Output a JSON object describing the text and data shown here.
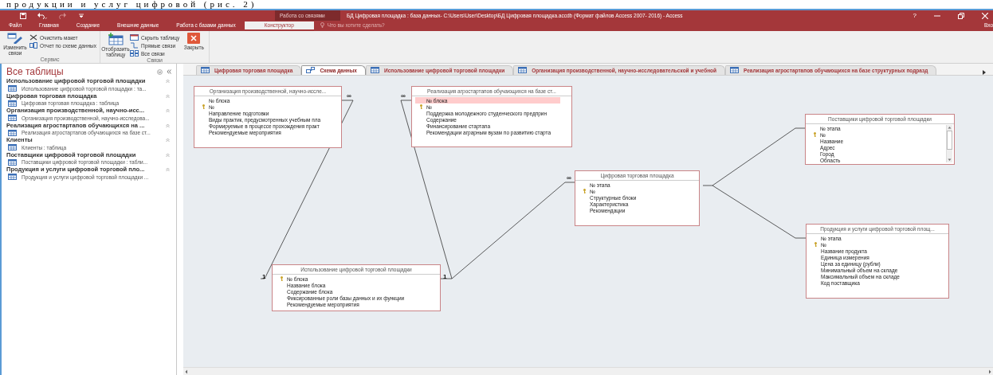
{
  "document_caption": "продукции и услуг цифровой (рис. 2)",
  "window": {
    "context_title": "Работа со связями",
    "title": "БД Цифровая площадка : база данных- C:\\Users\\User\\Desktop\\БД Цифровая площадка.accdb (Формат файлов Access 2007- 2016) - Access",
    "help": "?",
    "sign_in": "Вхо"
  },
  "ribbon_tabs": [
    {
      "label": "Файл",
      "selected": false
    },
    {
      "label": "Главная",
      "selected": false
    },
    {
      "label": "Создание",
      "selected": false
    },
    {
      "label": "Внешние данные",
      "selected": false
    },
    {
      "label": "Работа с базами данных",
      "selected": false
    },
    {
      "label": "Конструктор",
      "selected": true
    }
  ],
  "tell_me": {
    "placeholder": "Что вы хотите сделать?"
  },
  "ribbon_groups": [
    {
      "label": "Сервис",
      "items": [
        {
          "label": "Изменить связи",
          "kind": "large"
        },
        {
          "label": "Очистить макет",
          "kind": "small"
        },
        {
          "label": "Отчет по схеме данных",
          "kind": "small"
        }
      ]
    },
    {
      "label": "Связи",
      "items": [
        {
          "label": "Отобразить таблицу",
          "kind": "large"
        },
        {
          "label": "Скрыть таблицу",
          "kind": "small"
        },
        {
          "label": "Прямые связи",
          "kind": "small"
        },
        {
          "label": "Все связи",
          "kind": "small"
        },
        {
          "label": "Закрыть",
          "kind": "large"
        }
      ]
    }
  ],
  "navigation": {
    "title": "Все таблицы",
    "groups": [
      {
        "label": "Использование цифровой торговой площадки",
        "items": [
          "Использование цифровой торговой площадки : та..."
        ]
      },
      {
        "label": "Цифровая торговая площадка",
        "items": [
          "Цифровая торговая площадка : таблица"
        ]
      },
      {
        "label": "Организация производственной, научно-исс...",
        "items": [
          "Организация производственной, научно-исследова..."
        ]
      },
      {
        "label": "Реализация агростартапов обучающихся на ...",
        "items": [
          "Реализация агростартапов обучающихся на базе ст..."
        ]
      },
      {
        "label": "Клиенты",
        "items": [
          "Клиенты : таблица"
        ]
      },
      {
        "label": "Поставщики цифровой торговой площадки",
        "items": [
          "Поставщики цифровой торговой площадки : табли..."
        ]
      },
      {
        "label": "Продукция и услуги цифровой торговой пло...",
        "items": [
          "Продукция и услуги цифровой торговой площадки ..."
        ]
      }
    ]
  },
  "document_tabs": [
    {
      "label": "Цифровая торговая площадка",
      "kind": "table",
      "selected": false
    },
    {
      "label": "Схема данных",
      "kind": "relationships",
      "selected": true
    },
    {
      "label": "Использование цифровой торговой площадки",
      "kind": "table",
      "selected": false
    },
    {
      "label": "Организация производственной, научно-исследовательской и учебной",
      "kind": "table",
      "selected": false
    },
    {
      "label": "Реализация агростартапов обучающихся на базе структурных подразд",
      "kind": "table",
      "selected": false
    }
  ],
  "tables": [
    {
      "title": "Организация производственной, научно-иссле...",
      "fields": [
        {
          "name": "№ блока",
          "key": false,
          "selected": false
        },
        {
          "name": "№",
          "key": true,
          "selected": false
        },
        {
          "name": "Направление подготовки",
          "key": false,
          "selected": false
        },
        {
          "name": "Виды практик, предусмотренных учебным пла",
          "key": false,
          "selected": false
        },
        {
          "name": "Формируемые в процессе прохождения практ",
          "key": false,
          "selected": false
        },
        {
          "name": "Рекомендуемые мероприятия",
          "key": false,
          "selected": false
        }
      ]
    },
    {
      "title": "Реализация агростартапов обучающихся на базе ст...",
      "fields": [
        {
          "name": "№ блока",
          "key": false,
          "selected": true
        },
        {
          "name": "№",
          "key": true,
          "selected": false
        },
        {
          "name": "Поддержка молодежного студенческого предприн",
          "key": false,
          "selected": false
        },
        {
          "name": "Содержание",
          "key": false,
          "selected": false
        },
        {
          "name": "Финансирование стартапа",
          "key": false,
          "selected": false
        },
        {
          "name": "Рекомендации аграрным вузам по развитию старта",
          "key": false,
          "selected": false
        }
      ]
    },
    {
      "title": "Использование цифровой торговой площадки",
      "fields": [
        {
          "name": "№ блока",
          "key": true,
          "selected": false
        },
        {
          "name": "Название блока",
          "key": false,
          "selected": false
        },
        {
          "name": "Содержание блока",
          "key": false,
          "selected": false
        },
        {
          "name": "Фиксированные роли базы данных и их функции",
          "key": false,
          "selected": false
        },
        {
          "name": "Рекомендуемые мероприятия",
          "key": false,
          "selected": false
        }
      ]
    },
    {
      "title": "Цифровая торговая площадка",
      "fields": [
        {
          "name": "№ этапа",
          "key": false,
          "selected": false
        },
        {
          "name": "№",
          "key": true,
          "selected": false
        },
        {
          "name": "Структурные блоки",
          "key": false,
          "selected": false
        },
        {
          "name": "Характеристика",
          "key": false,
          "selected": false
        },
        {
          "name": "Рекомендации",
          "key": false,
          "selected": false
        }
      ]
    },
    {
      "title": "Поставщики цифровой торговой площадки",
      "fields": [
        {
          "name": "№ этапа",
          "key": false,
          "selected": false
        },
        {
          "name": "№",
          "key": true,
          "selected": false
        },
        {
          "name": "Название",
          "key": false,
          "selected": false
        },
        {
          "name": "Адрес",
          "key": false,
          "selected": false
        },
        {
          "name": "Город",
          "key": false,
          "selected": false
        },
        {
          "name": "Область",
          "key": false,
          "selected": false
        }
      ]
    },
    {
      "title": "Продукция и услуги цифровой торговой площ...",
      "fields": [
        {
          "name": "№ этапа",
          "key": false,
          "selected": false
        },
        {
          "name": "№",
          "key": true,
          "selected": false
        },
        {
          "name": "Название продукта",
          "key": false,
          "selected": false
        },
        {
          "name": "Единица измерения",
          "key": false,
          "selected": false
        },
        {
          "name": "Цена за единицу (рубли)",
          "key": false,
          "selected": false
        },
        {
          "name": "Минимальный объем на складе",
          "key": false,
          "selected": false
        },
        {
          "name": "Максимальный объем на складе",
          "key": false,
          "selected": false
        },
        {
          "name": "Код поставщика",
          "key": false,
          "selected": false
        }
      ]
    }
  ],
  "relationship_marks": [
    {
      "text": "∞"
    },
    {
      "text": "1"
    },
    {
      "text": "∞"
    },
    {
      "text": "1"
    },
    {
      "text": "∞"
    }
  ]
}
